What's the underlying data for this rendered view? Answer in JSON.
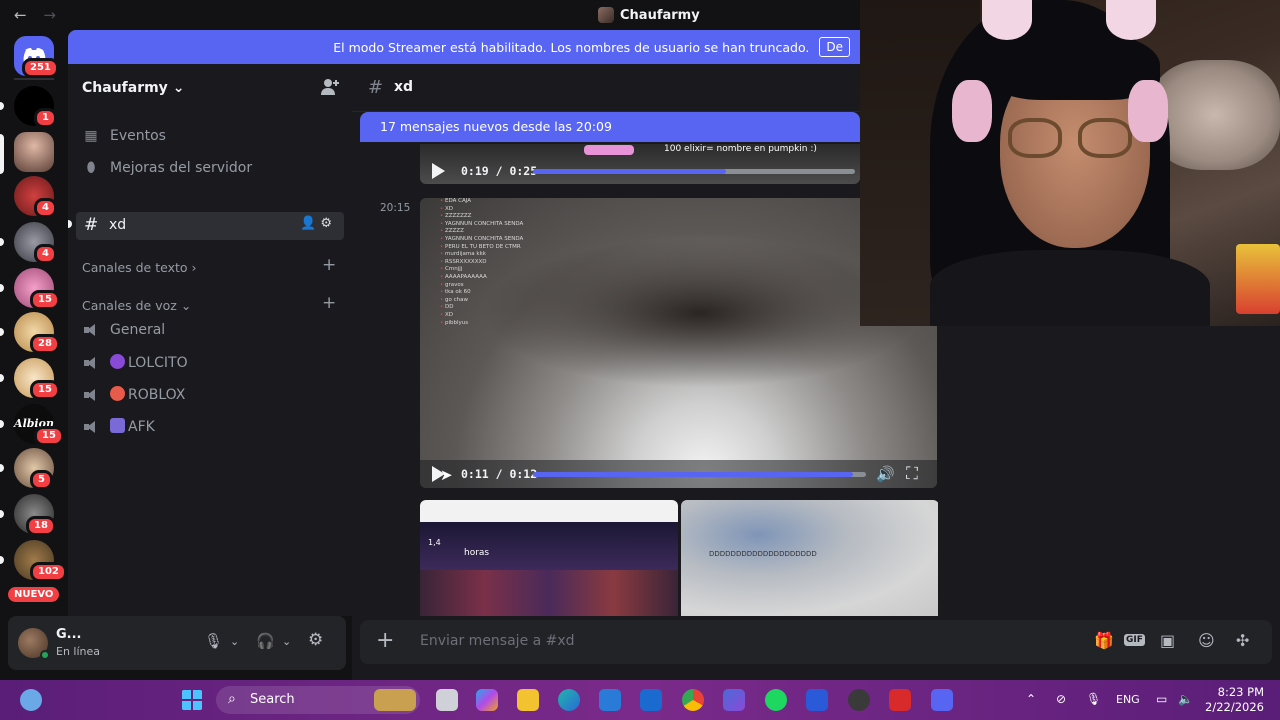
{
  "titlebar": {
    "back_arrow": "←",
    "forward_arrow": "→",
    "title": "Chaufarmy"
  },
  "rail": {
    "home_badge": "251",
    "badges": [
      "1",
      "4",
      "4",
      "15",
      "28",
      "15",
      "15",
      "5",
      "18",
      "102"
    ],
    "server_wordmark": "Albion",
    "nuevo": "NUEVO"
  },
  "banner": {
    "text": "El modo Streamer está habilitado. Los nombres de usuario se han truncado.",
    "button": "De"
  },
  "sidebar": {
    "server_name": "Chaufarmy",
    "items": [
      {
        "label": "Eventos",
        "icon": "calendar-icon"
      },
      {
        "label": "Mejoras del servidor",
        "icon": "boost-icon"
      }
    ],
    "active_channel": "xd",
    "categories": {
      "text": "Canales de texto",
      "voice": "Canales de voz"
    },
    "voice_channels": [
      "General",
      "LOLCITO",
      "ROBLOX",
      "AFK"
    ]
  },
  "user": {
    "name": "G...",
    "status": "En línea"
  },
  "chat": {
    "channel": "xd",
    "new_messages": "17 mensajes nuevos desde las 20:09",
    "top_video": {
      "time": "0:19 / 0:25",
      "progress": 0.6,
      "overlay": "100 elixir= nombre en pumpkin :)"
    },
    "message_time": "20:15",
    "main_video": {
      "time": "0:11 / 0:12",
      "progress": 0.96,
      "overlay_lines": [
        "EDA CAJA",
        "XD",
        "ZZZZZZZ",
        "YAGNNUN CONCHITA SENDA",
        "ZZZZZ",
        "YAGNNUN CONCHITA SENDA",
        "PERU EL TU BETO DE CTMR",
        "murdijama kkk",
        "RSSRXXXXXXD",
        "Cmnjjj",
        "AAAAPAAAAAA",
        "gravos",
        "tka ok 60",
        "go chaw",
        "DD",
        "XD",
        "pibblyus"
      ]
    },
    "thumb1_text": {
      "a": "1,4",
      "b": "horas"
    },
    "thumb2_text": "DDDDDDDDDDDDDDDDDDDD",
    "composer_placeholder": "Enviar mensaje a #xd",
    "gif_label": "GIF"
  },
  "taskbar": {
    "search": "Search",
    "language": "ENG",
    "time": "8:23 PM",
    "date": "2/22/2026",
    "colors": {
      "accent": "#5865f2",
      "taskbar": "#7a2a8a"
    }
  }
}
